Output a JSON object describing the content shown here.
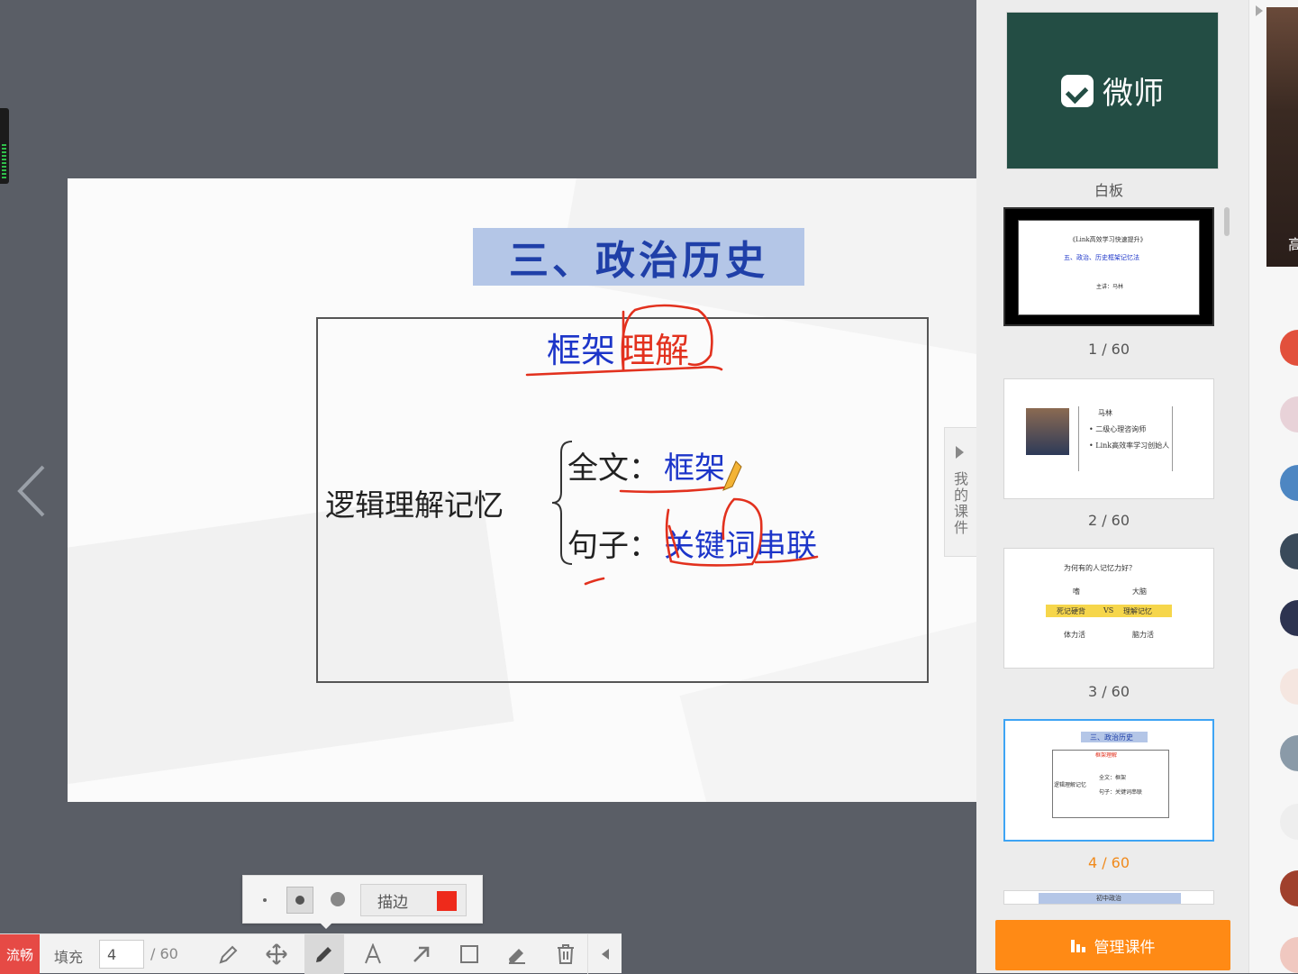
{
  "slide": {
    "title": "三、政治历史",
    "heading_blue": "框架",
    "heading_red": "理解",
    "root_label": "逻辑理解记忆",
    "branch1_key": "全文：",
    "branch1_value": "框架",
    "branch2_key": "句子：",
    "branch2_value": "关键词串联"
  },
  "course_tab": {
    "label": "我的课件"
  },
  "panel": {
    "whiteboard_logo_text": "微师",
    "whiteboard_label": "白板",
    "thumbnails": [
      {
        "page_label": "1 / 60",
        "lines": [
          "《Link高效学习快速提升》",
          "五、政治、历史框架记忆法",
          "主讲：马林"
        ]
      },
      {
        "page_label": "2 / 60",
        "lines": [
          "马林",
          "• 二级心理咨询师",
          "• Link高效率学习创始人"
        ]
      },
      {
        "page_label": "3 / 60",
        "lines": [
          "为何有的人记忆力好？",
          "嗜",
          "大脑",
          "死记硬背",
          "VS",
          "理解记忆",
          "体力活",
          "脑力活"
        ]
      },
      {
        "page_label": "4 / 60",
        "lines": [
          "三、政治历史",
          "框架理解",
          "全文：框架",
          "逻辑理解记忆",
          "句子：关键词串联"
        ]
      },
      {
        "page_label": "",
        "lines": [
          "初中政治"
        ]
      }
    ],
    "current_page_label": "4 / 60",
    "manage_button": "管理课件"
  },
  "video": {
    "name_initial": "高"
  },
  "pen_popup": {
    "stroke_label": "描边",
    "stroke_color": "#ee2a1b"
  },
  "toolbar": {
    "smooth_badge": "流畅",
    "fill_label": "填充",
    "page_value": "4",
    "page_total": "/ 60",
    "tools": [
      "pen-icon",
      "move-icon",
      "pencil-icon",
      "text-icon",
      "arrow-icon",
      "rectangle-icon",
      "eraser-icon",
      "trash-icon",
      "collapse-left-icon"
    ]
  },
  "colors": {
    "accent_orange": "#ff8a15",
    "selected_blue": "#3ea4f4",
    "current_page_orange": "#f08a1c",
    "ink_red": "#e2311e",
    "title_blue": "#1c35c9"
  }
}
